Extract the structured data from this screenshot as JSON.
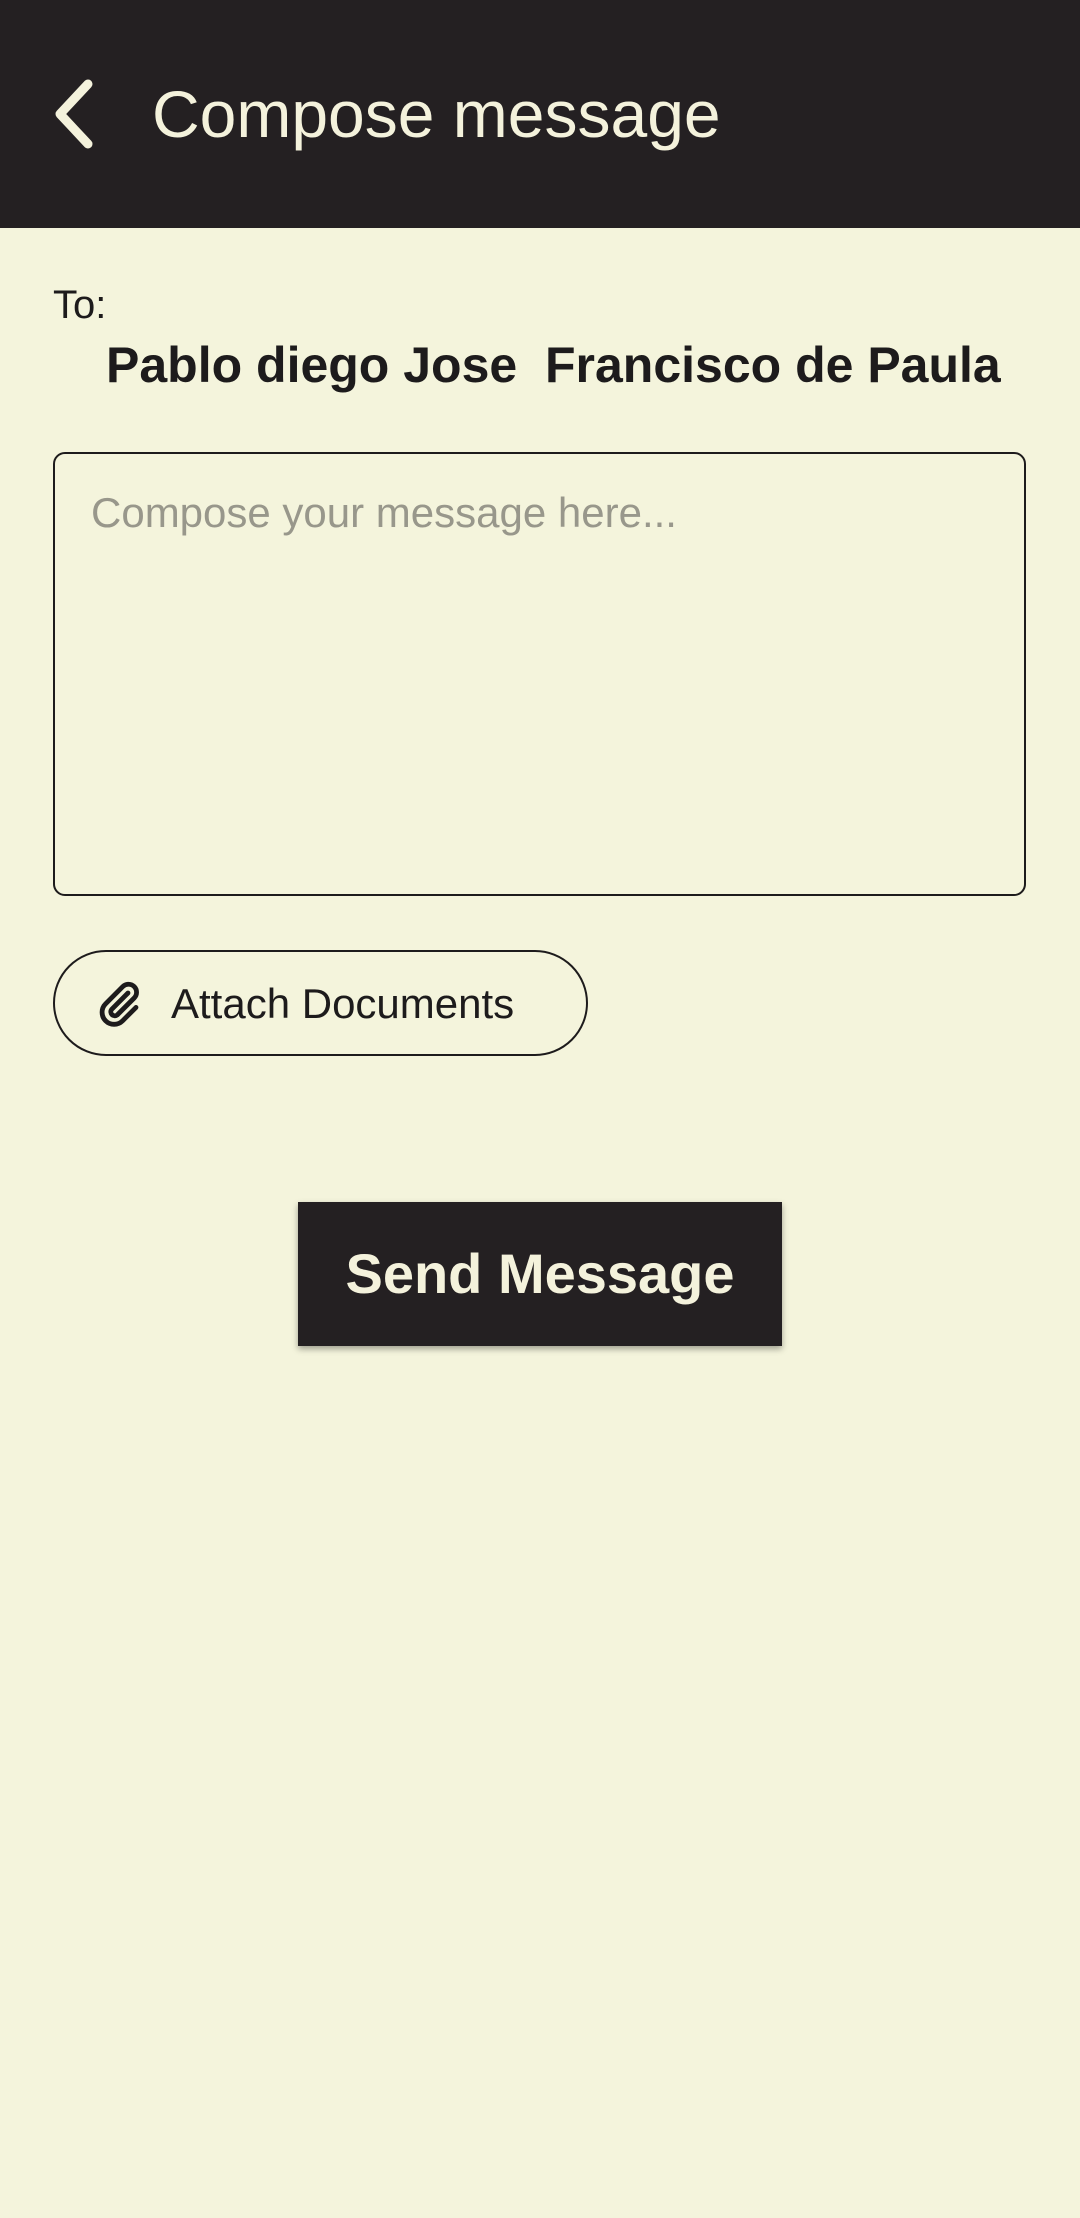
{
  "app_bar": {
    "back_icon": "chevron-left-icon",
    "title": "Compose message",
    "background_color": "#242022",
    "title_color": "#f4f2dc"
  },
  "recipient": {
    "label": "To:",
    "name": "Pablo diego Jose  Francisco de Paula"
  },
  "message": {
    "value": "",
    "placeholder": "Compose your message here..."
  },
  "attach": {
    "icon": "paperclip-icon",
    "label": "Attach Documents"
  },
  "send": {
    "label": "Send Message",
    "background_color": "#242022",
    "label_color": "#f4f2dc"
  },
  "page": {
    "background_color": "#f4f4dc"
  }
}
